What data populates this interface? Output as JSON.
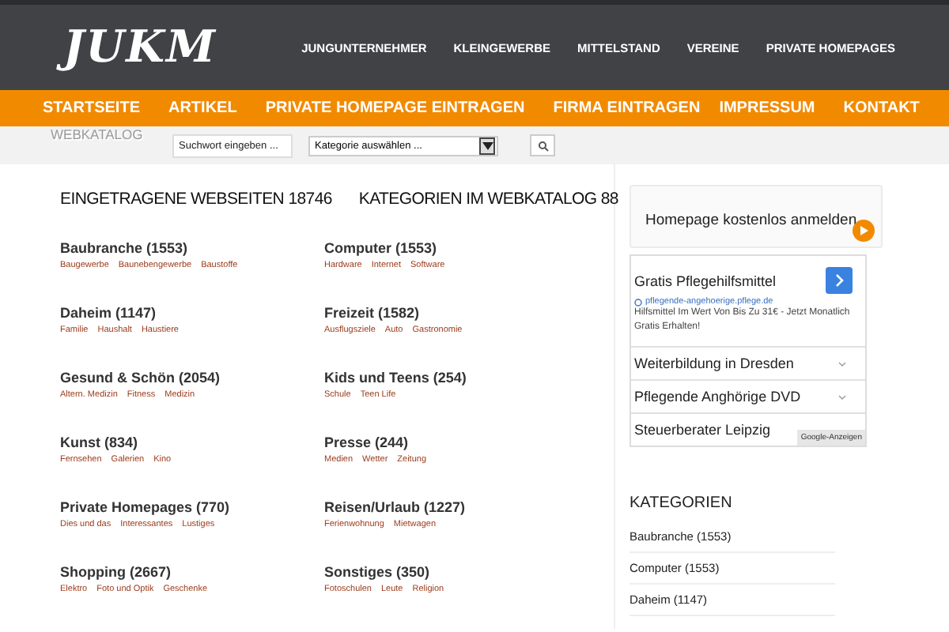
{
  "header": {
    "logo": "JUKM",
    "top_nav": [
      "JUNGUNTERNEHMER",
      "KLEINGEWERBE",
      "MITTELSTAND",
      "VEREINE",
      "PRIVATE HOMEPAGES"
    ]
  },
  "main_nav": [
    "STARTSEITE",
    "ARTIKEL",
    "PRIVATE HOMEPAGE EINTRAGEN",
    "FIRMA EINTRAGEN",
    "IMPRESSUM",
    "KONTAKT"
  ],
  "search_bar": {
    "label": "WEBKATALOG",
    "placeholder": "Suchwort eingeben ...",
    "category_select": "Kategorie auswählen ..."
  },
  "headings": [
    "EINGETRAGENE WEBSEITEN 18746",
    "KATEGORIEN IM WEBKATALOG 88"
  ],
  "categories": [
    {
      "title": "Baubranche (1553)",
      "subs": [
        "Baugewerbe",
        "Baunebengewerbe",
        "Baustoffe"
      ]
    },
    {
      "title": "Computer (1553)",
      "subs": [
        "Hardware",
        "Internet",
        "Software"
      ]
    },
    {
      "title": "Daheim (1147)",
      "subs": [
        "Familie",
        "Haushalt",
        "Haustiere"
      ]
    },
    {
      "title": "Freizeit (1582)",
      "subs": [
        "Ausflugsziele",
        "Auto",
        "Gastronomie"
      ]
    },
    {
      "title": "Gesund & Schön (2054)",
      "subs": [
        "Altern. Medizin",
        "Fitness",
        "Medizin"
      ]
    },
    {
      "title": "Kids und Teens (254)",
      "subs": [
        "Schule",
        "Teen Life"
      ]
    },
    {
      "title": "Kunst (834)",
      "subs": [
        "Fernsehen",
        "Galerien",
        "Kino"
      ]
    },
    {
      "title": "Presse (244)",
      "subs": [
        "Medien",
        "Wetter",
        "Zeitung"
      ]
    },
    {
      "title": "Private Homepages (770)",
      "subs": [
        "Dies und das",
        "Interessantes",
        "Lustiges"
      ]
    },
    {
      "title": "Reisen/Urlaub (1227)",
      "subs": [
        "Ferienwohnung",
        "Mietwagen"
      ]
    },
    {
      "title": "Shopping (2667)",
      "subs": [
        "Elektro",
        "Foto und Optik",
        "Geschenke"
      ]
    },
    {
      "title": "Sonstiges (350)",
      "subs": [
        "Fotoschulen",
        "Leute",
        "Religion"
      ]
    }
  ],
  "sidebar": {
    "promo": "Homepage kostenlos anmelden",
    "ad": {
      "title": "Gratis Pflegehilfsmittel",
      "url": "pflegende-angehoerige.pflege.de",
      "text": "Hilfsmittel Im Wert Von Bis Zu 31€ - Jetzt Monatlich Gratis Erhalten!",
      "links": [
        "Weiterbildung in Dresden",
        "Pflegende Anghörige DVD",
        "Steuerberater Leipzig"
      ],
      "badge": "Google-Anzeigen"
    },
    "heading": "KATEGORIEN",
    "items": [
      "Baubranche (1553)",
      "Computer (1553)",
      "Daheim (1147)"
    ]
  }
}
